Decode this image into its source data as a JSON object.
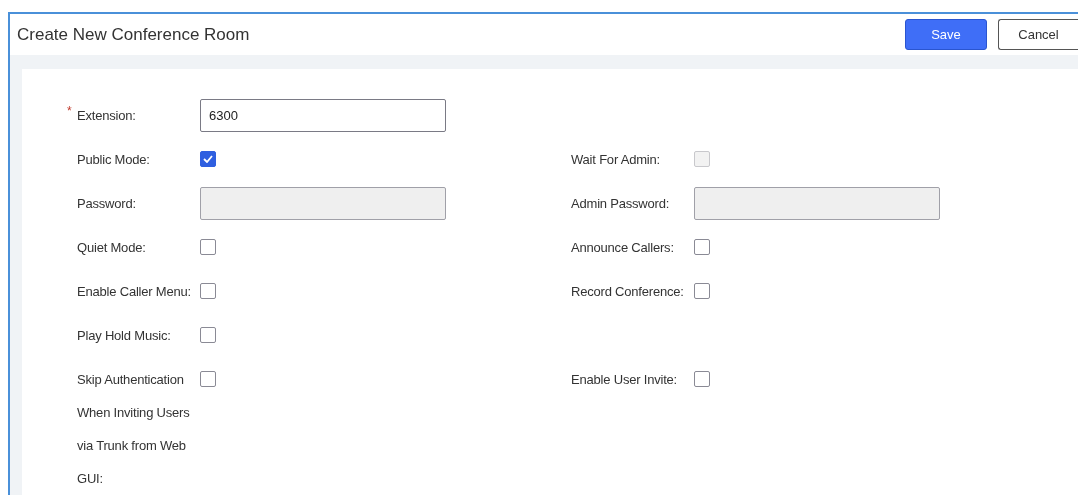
{
  "window": {
    "title": "Create New Conference Room"
  },
  "buttons": [
    {
      "label": "Save",
      "kind": "primary"
    },
    {
      "label": "Cancel",
      "kind": "secondary"
    }
  ],
  "rows": [
    {
      "left": {
        "label": "Extension:",
        "kind": "text",
        "required_mark": "*",
        "value": "6300",
        "disabled": false
      }
    },
    {
      "left": {
        "label": "Public Mode:",
        "kind": "checkbox",
        "checked": true
      },
      "right": {
        "label": "Wait For Admin:",
        "kind": "checkbox",
        "checked": false,
        "disabled": true
      }
    },
    {
      "left": {
        "label": "Password:",
        "kind": "text",
        "disabled": true
      },
      "right": {
        "label": "Admin Password:",
        "kind": "text",
        "disabled": true
      }
    },
    {
      "left": {
        "label": "Quiet Mode:",
        "kind": "checkbox",
        "checked": false,
        "disabled": false
      },
      "right": {
        "label": "Announce Callers:",
        "kind": "checkbox",
        "checked": false,
        "disabled": false
      }
    },
    {
      "left": {
        "label": "Enable Caller Menu:",
        "kind": "checkbox",
        "checked": false,
        "disabled": false
      },
      "right": {
        "label": "Record Conference:",
        "kind": "checkbox",
        "checked": false,
        "disabled": false
      }
    },
    {
      "left": {
        "label": "Play Hold Music:",
        "kind": "checkbox",
        "checked": false,
        "disabled": false
      }
    },
    {
      "left": {
        "label": "Skip Authentication When Inviting Users via Trunk from Web GUI:",
        "kind": "checkbox",
        "checked": false,
        "disabled": false
      },
      "right": {
        "label": "Enable User Invite:",
        "kind": "checkbox",
        "checked": false,
        "disabled": false
      }
    }
  ]
}
